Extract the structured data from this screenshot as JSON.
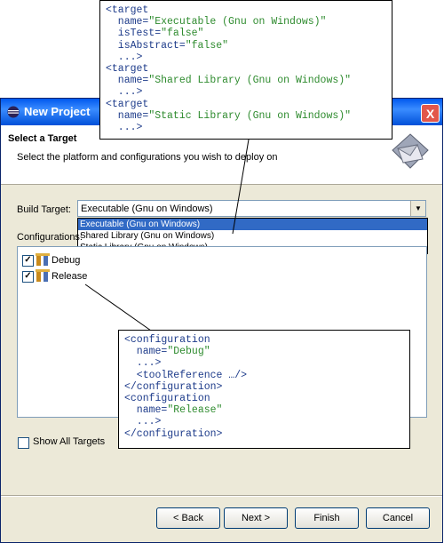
{
  "window": {
    "title": "New Project",
    "close_label": "X"
  },
  "header": {
    "title": "Select a Target",
    "description": "Select the platform and configurations you wish to deploy on"
  },
  "build_target": {
    "label": "Build Target:",
    "selected": "Executable (Gnu on Windows)",
    "options": [
      "Executable (Gnu on Windows)",
      "Shared Library (Gnu on Windows)",
      "Static Library (Gnu on Windows)"
    ]
  },
  "configurations": {
    "label": "Configurations:",
    "items": [
      {
        "label": "Debug",
        "checked": true
      },
      {
        "label": "Release",
        "checked": true
      }
    ]
  },
  "show_all": {
    "label": "Show All Targets",
    "checked": false
  },
  "buttons": {
    "back": "< Back",
    "next": "Next >",
    "finish": "Finish",
    "cancel": "Cancel"
  },
  "callout_target": {
    "lines": [
      [
        {
          "t": "<target",
          "c": "k"
        }
      ],
      [
        {
          "t": "  name=",
          "c": "k"
        },
        {
          "t": "\"Executable (Gnu on Windows)\"",
          "c": "q"
        }
      ],
      [
        {
          "t": "  isTest=",
          "c": "k"
        },
        {
          "t": "\"false\"",
          "c": "q"
        }
      ],
      [
        {
          "t": "  isAbstract=",
          "c": "k"
        },
        {
          "t": "\"false\"",
          "c": "q"
        }
      ],
      [
        {
          "t": "  ...>",
          "c": "k"
        }
      ],
      [
        {
          "t": "<target",
          "c": "k"
        }
      ],
      [
        {
          "t": "  name=",
          "c": "k"
        },
        {
          "t": "\"Shared Library (Gnu on Windows)\"",
          "c": "q"
        }
      ],
      [
        {
          "t": "  ...>",
          "c": "k"
        }
      ],
      [
        {
          "t": "<target",
          "c": "k"
        }
      ],
      [
        {
          "t": "  name=",
          "c": "k"
        },
        {
          "t": "\"Static Library (Gnu on Windows)\"",
          "c": "q"
        }
      ],
      [
        {
          "t": "  ...>",
          "c": "k"
        }
      ]
    ]
  },
  "callout_config": {
    "lines": [
      [
        {
          "t": "<configuration",
          "c": "k"
        }
      ],
      [
        {
          "t": "  name=",
          "c": "k"
        },
        {
          "t": "\"Debug\"",
          "c": "q"
        }
      ],
      [
        {
          "t": "  ...>",
          "c": "k"
        }
      ],
      [
        {
          "t": "  <toolReference …/>",
          "c": "k"
        }
      ],
      [
        {
          "t": "</configuration>",
          "c": "k"
        }
      ],
      [
        {
          "t": "<configuration",
          "c": "k"
        }
      ],
      [
        {
          "t": "  name=",
          "c": "k"
        },
        {
          "t": "\"Release\"",
          "c": "q"
        }
      ],
      [
        {
          "t": "  ...>",
          "c": "k"
        }
      ],
      [
        {
          "t": "</configuration>",
          "c": "k"
        }
      ]
    ]
  }
}
